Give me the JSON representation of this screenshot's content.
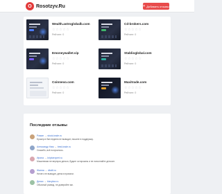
{
  "header": {
    "logo_letter": "O",
    "logo_text": "Rosotzyv.Ru",
    "add_button_label": "Добавить отзывы"
  },
  "cards": [
    {
      "name": "Wealth.astroglobalb.com",
      "stars": "☆☆☆☆☆",
      "reviews": "Рейтинг: 0"
    },
    {
      "name": "Cd-brokers.com",
      "stars": "☆☆☆☆☆",
      "reviews": "Рейтинг: 0"
    },
    {
      "name": "Emoneywallet.vip",
      "stars": "☆☆☆☆☆",
      "reviews": "Рейтинг: 0"
    },
    {
      "name": "Stablioglobal.com",
      "stars": "☆☆☆☆☆",
      "reviews": "Рейтинг: 0"
    },
    {
      "name": "Coinnexo.com",
      "stars": "☆☆☆☆☆",
      "reviews": "Рейтинг: 0"
    },
    {
      "name": "Maxitrade.com",
      "stars": "☆☆☆☆☆",
      "reviews": "Рейтинг: 0"
    }
  ],
  "feed": {
    "title": "Последние отзывы",
    "items": [
      {
        "author": "Роман",
        "site": "stock-trade.ru",
        "text": "Брокер в бан неделю не выводит, пишите в поддержку."
      },
      {
        "author": "Александр Нам",
        "site": "best-trade.ru",
        "text": "Спасибо, всё получилось."
      },
      {
        "author": "Ирина",
        "site": "kriptoexpert.ru",
        "text": "Мошенники не вернули деньги, будьте осторожны и не пополняйте депозит."
      },
      {
        "author": "Жанна",
        "site": "dbvitt.ru",
        "text": "Ничего не выводят, деньги пропали."
      },
      {
        "author": "Денис",
        "site": "bizvybor.ru",
        "text": "Обычный развод, не доверяйте им."
      }
    ]
  },
  "colors": {
    "accent": "#e84c4c",
    "link": "#3a6fd1",
    "background": "#eef0f3"
  }
}
